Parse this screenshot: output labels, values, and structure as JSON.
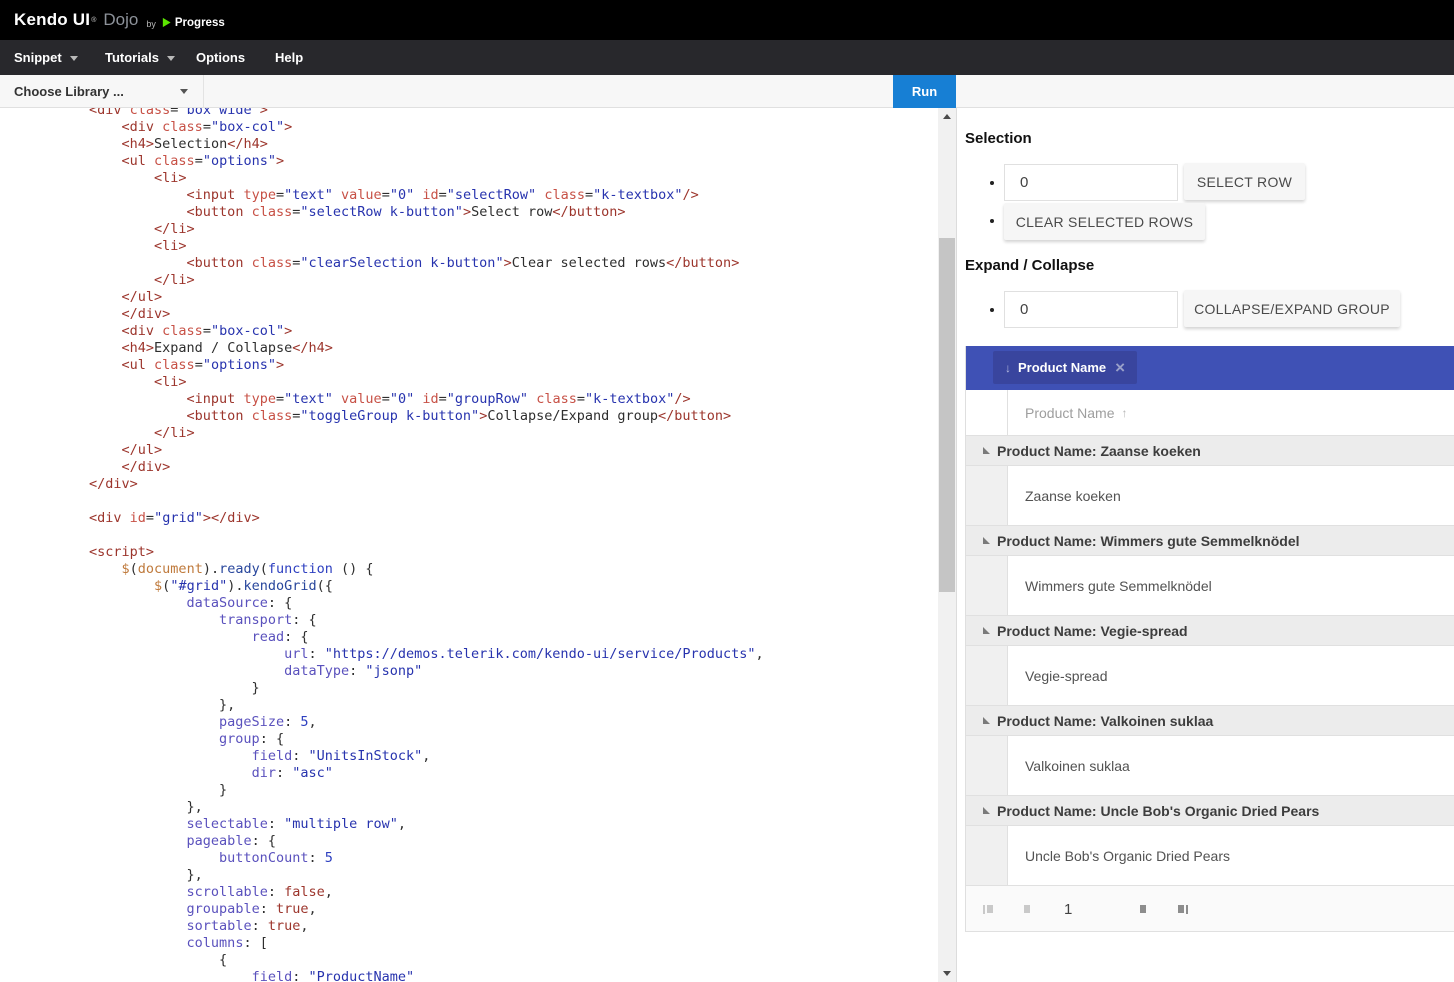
{
  "header": {
    "brand": "Kendo UI",
    "registered": "®",
    "product": "Dojo",
    "by": "by",
    "progress": "Progress"
  },
  "menu": {
    "items": [
      {
        "label": "Snippet"
      },
      {
        "label": "Tutorials"
      },
      {
        "label": "Options"
      },
      {
        "label": "Help"
      }
    ]
  },
  "toolbar": {
    "library_placeholder": "Choose Library ...",
    "run_label": "Run"
  },
  "editor": {
    "lines": [
      "<div class=\"box wide\">",
      "    <div class=\"box-col\">",
      "    <h4>Selection</h4>",
      "    <ul class=\"options\">",
      "        <li>",
      "            <input type=\"text\" value=\"0\" id=\"selectRow\" class=\"k-textbox\"/>",
      "            <button class=\"selectRow k-button\">Select row</button>",
      "        </li>",
      "        <li>",
      "            <button class=\"clearSelection k-button\">Clear selected rows</button>",
      "        </li>",
      "    </ul>",
      "    </div>",
      "    <div class=\"box-col\">",
      "    <h4>Expand / Collapse</h4>",
      "    <ul class=\"options\">",
      "        <li>",
      "            <input type=\"text\" value=\"0\" id=\"groupRow\" class=\"k-textbox\"/>",
      "            <button class=\"toggleGroup k-button\">Collapse/Expand group</button>",
      "        </li>",
      "    </ul>",
      "    </div>",
      "</div>",
      "",
      "<div id=\"grid\"></div>",
      "",
      "<script>",
      "    $(document).ready(function () {",
      "        $(\"#grid\").kendoGrid({",
      "            dataSource: {",
      "                transport: {",
      "                    read: {",
      "                        url: \"https://demos.telerik.com/kendo-ui/service/Products\",",
      "                        dataType: \"jsonp\"",
      "                    }",
      "                },",
      "                pageSize: 5,",
      "                group: {",
      "                    field: \"UnitsInStock\",",
      "                    dir: \"asc\"",
      "                }",
      "            },",
      "            selectable: \"multiple row\",",
      "            pageable: {",
      "                buttonCount: 5",
      "            },",
      "            scrollable: false,",
      "            groupable: true,",
      "            sortable: true,",
      "            columns: [",
      "                {",
      "                    field: \"ProductName\""
    ]
  },
  "preview": {
    "selection_heading": "Selection",
    "select_row_input": "0",
    "select_row_button": "SELECT ROW",
    "clear_rows_button": "CLEAR SELECTED ROWS",
    "expand_heading": "Expand / Collapse",
    "group_input": "0",
    "toggle_group_button": "COLLAPSE/EXPAND GROUP",
    "grid": {
      "group_chip_label": "Product Name",
      "column_header": "Product Name",
      "groups": [
        {
          "label": "Product Name: Zaanse koeken",
          "row": "Zaanse koeken"
        },
        {
          "label": "Product Name: Wimmers gute Semmelknödel",
          "row": "Wimmers gute Semmelknödel"
        },
        {
          "label": "Product Name: Vegie-spread",
          "row": "Vegie-spread"
        },
        {
          "label": "Product Name: Valkoinen suklaa",
          "row": "Valkoinen suklaa"
        },
        {
          "label": "Product Name: Uncle Bob's Organic Dried Pears",
          "row": "Uncle Bob's Organic Dried Pears"
        }
      ],
      "pager": {
        "current_page": "1"
      }
    }
  },
  "icons": {
    "sort_ascending": "↑",
    "chip_sort_descending": "↓",
    "chip_remove": "×"
  },
  "colors": {
    "run_button": "#177fd4",
    "group_bar": "#3f51b5",
    "group_chip": "#39459e"
  }
}
